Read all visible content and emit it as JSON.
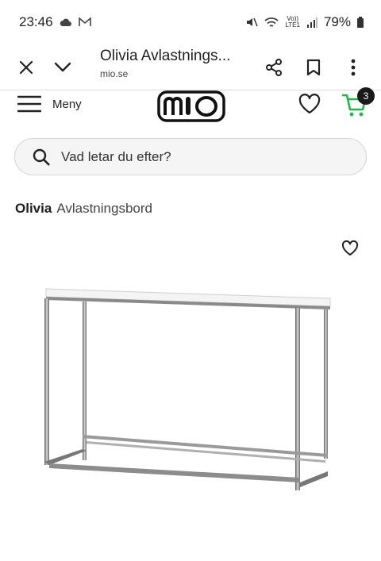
{
  "status_bar": {
    "time": "23:46",
    "battery": "79%",
    "network_label": "LTE1"
  },
  "browser": {
    "page_title": "Olivia Avlastnings...",
    "url": "mio.se"
  },
  "site": {
    "menu_label": "Meny",
    "logo_text": "miO",
    "cart_count": "3",
    "accent_color": "#2bb24c"
  },
  "search": {
    "placeholder": "Vad letar du efter?"
  },
  "product": {
    "brand": "Olivia",
    "type": "Avlastningsbord"
  },
  "icons": [
    "close-icon",
    "chevron-down-icon",
    "share-icon",
    "bookmark-icon",
    "more-vert-icon",
    "hamburger-icon",
    "heart-icon",
    "cart-icon",
    "search-icon"
  ]
}
